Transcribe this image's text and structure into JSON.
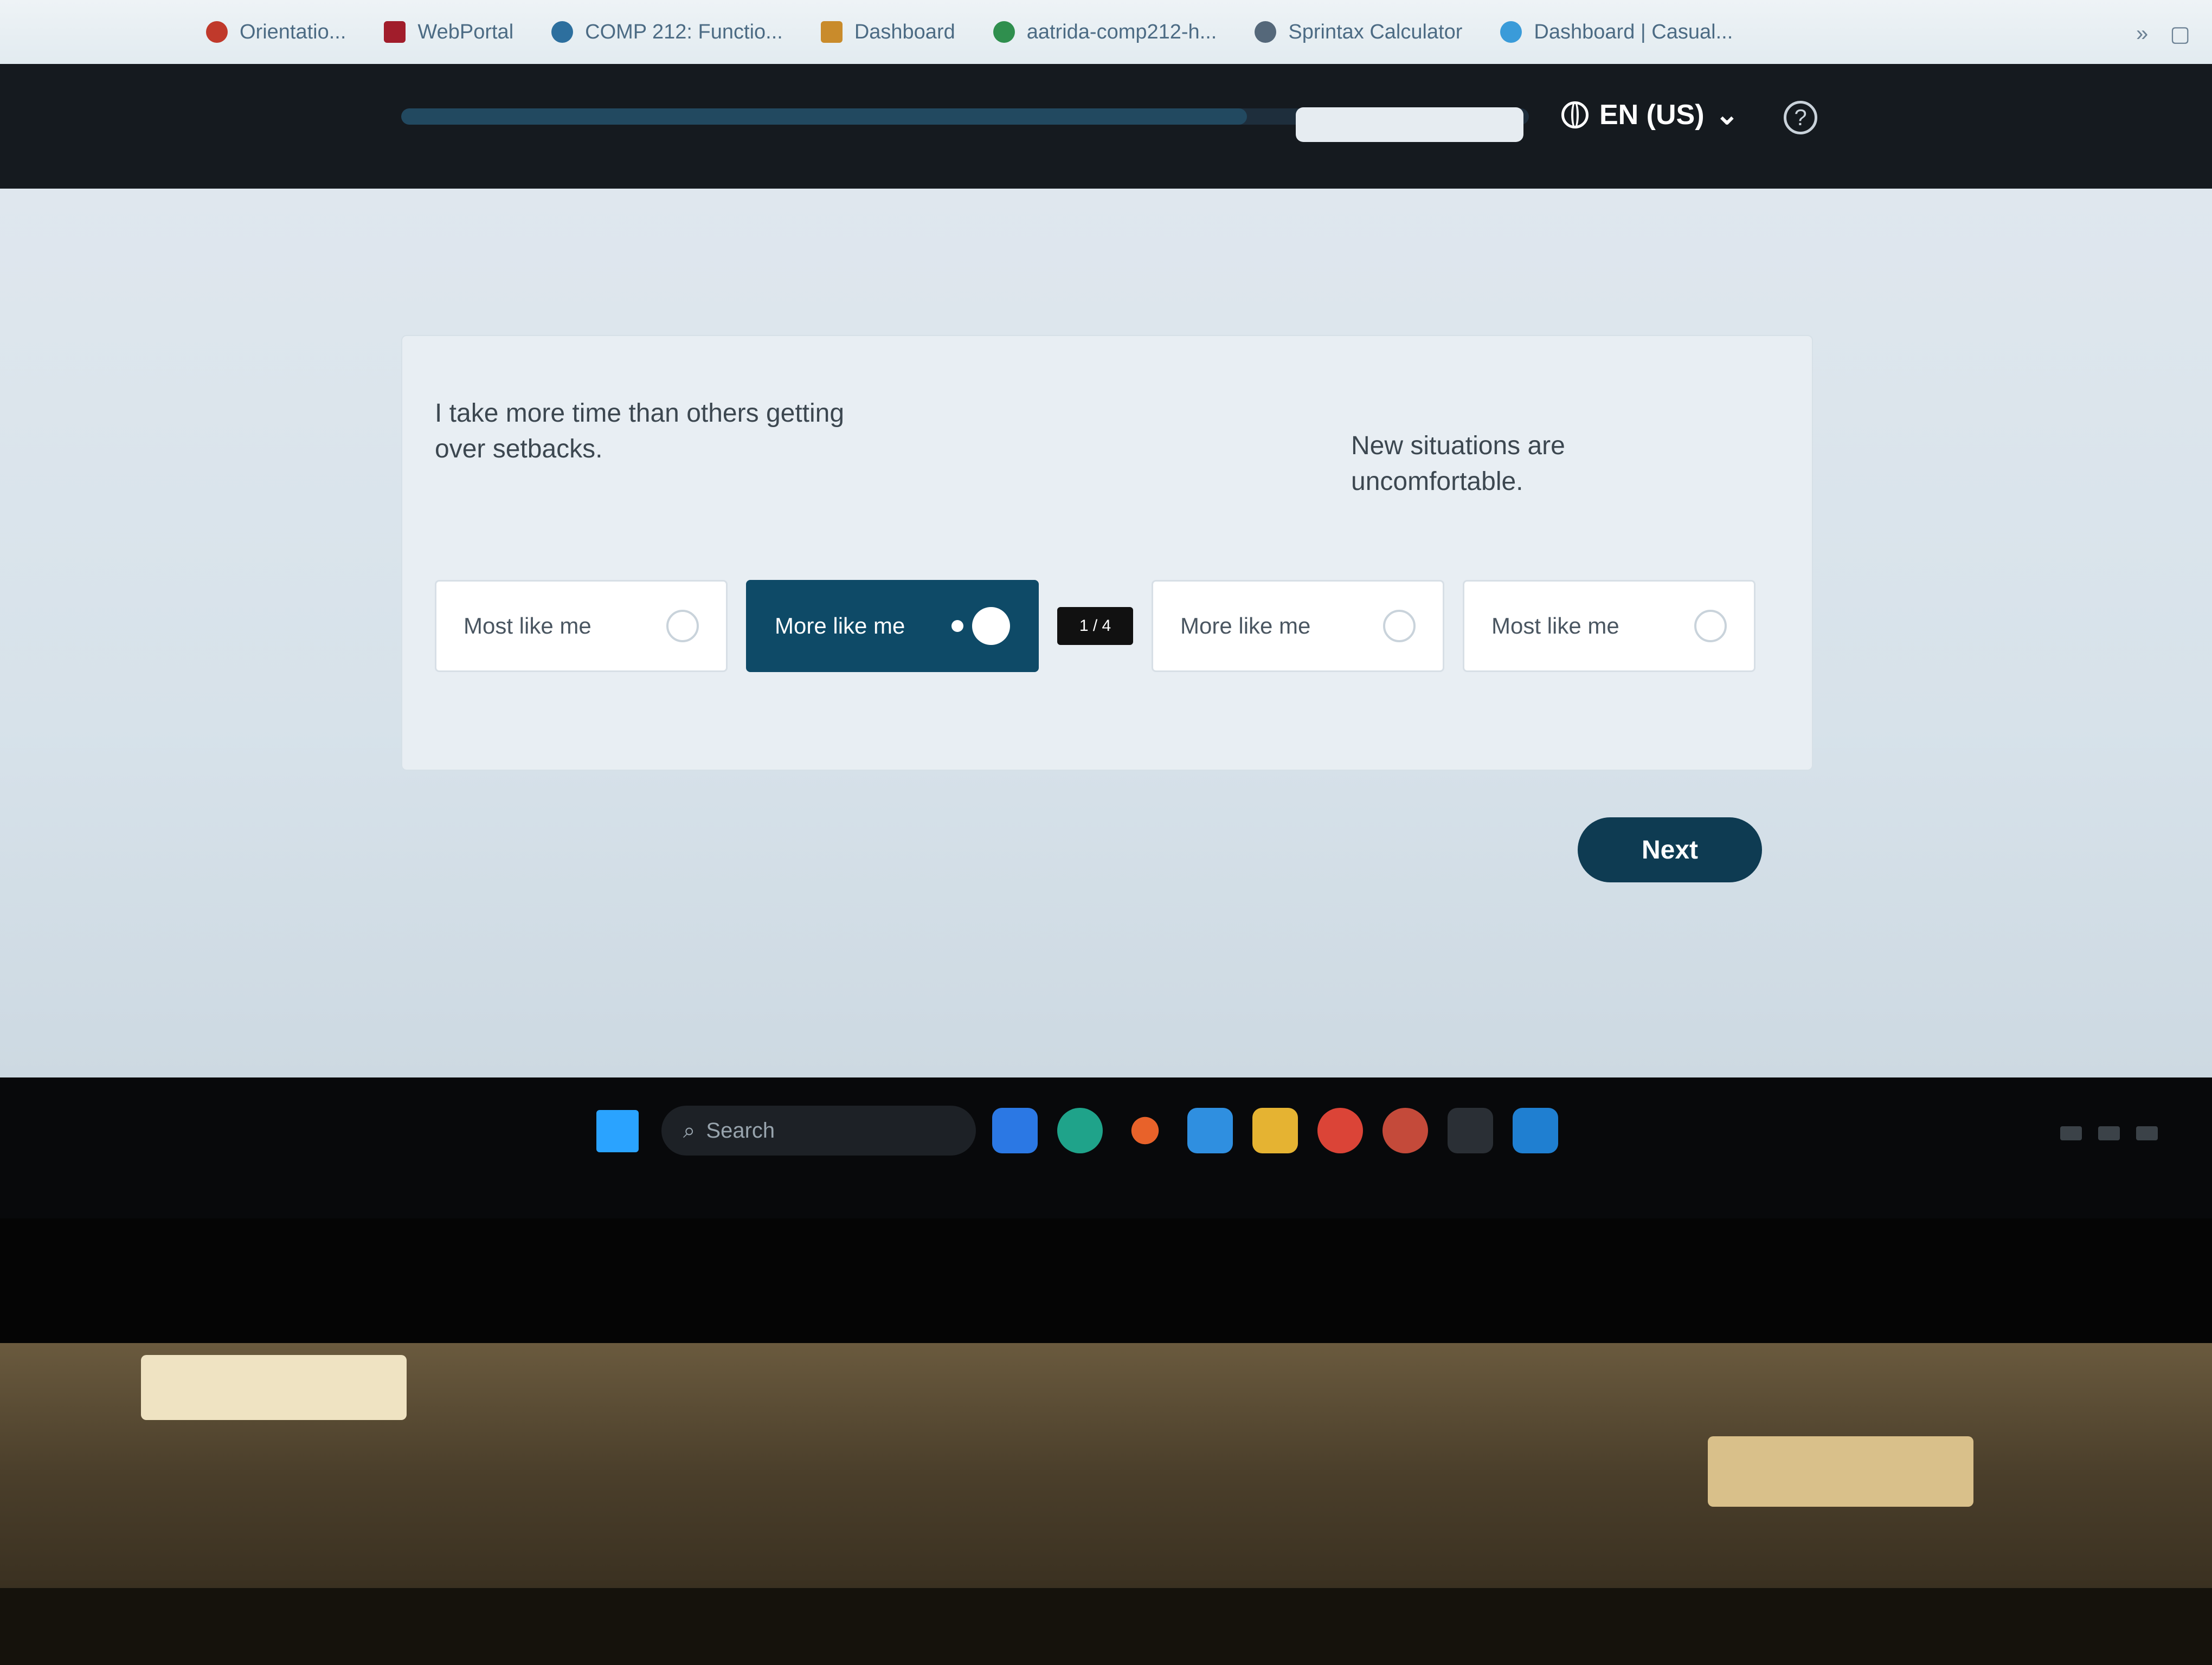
{
  "bookmarks": [
    {
      "label": "Orientatio...",
      "icon": "red-bookmark-icon",
      "color": "#c0392b"
    },
    {
      "label": "WebPortal",
      "icon": "webportal-icon",
      "color": "#a11d2b"
    },
    {
      "label": "COMP 212: Functio...",
      "icon": "globe-icon",
      "color": "#2d6f9e"
    },
    {
      "label": "Dashboard",
      "icon": "dashboard-icon",
      "color": "#c98b2b"
    },
    {
      "label": "aatrida-comp212-h...",
      "icon": "drive-icon",
      "color": "#2f8f4e"
    },
    {
      "label": "Sprintax Calculator",
      "icon": "sprintax-icon",
      "color": "#55687a"
    },
    {
      "label": "Dashboard | Casual...",
      "icon": "casual-icon",
      "color": "#3a9bd9"
    }
  ],
  "header": {
    "language": "EN (US)",
    "help_symbol": "?",
    "progress": 0.75
  },
  "question": {
    "left_statement": "I take more time than others getting over setbacks.",
    "right_statement": "New situations are uncomfortable.",
    "options": [
      {
        "label": "Most like me",
        "selected": false
      },
      {
        "label": "More like me",
        "selected": true
      },
      {
        "label": "More like me",
        "selected": false
      },
      {
        "label": "Most like me",
        "selected": false
      }
    ],
    "tooltip": "1 / 4"
  },
  "next_button": "Next",
  "taskbar": {
    "search_placeholder": "Search",
    "apps": [
      {
        "icon": "copilot-icon",
        "color": "#2b78e4"
      },
      {
        "icon": "edge-icon",
        "color": "#1fa38a"
      },
      {
        "icon": "firefox-icon",
        "color": "#e8622a"
      },
      {
        "icon": "store-icon",
        "color": "#2f8fe0"
      },
      {
        "icon": "file-explorer-icon",
        "color": "#e5b332"
      },
      {
        "icon": "chrome-icon",
        "color": "#db4437"
      },
      {
        "icon": "chrome-profile-icon",
        "color": "#c44a3a"
      },
      {
        "icon": "terminal-icon",
        "color": "#2a2f35"
      },
      {
        "icon": "vscode-icon",
        "color": "#1f7fd1"
      }
    ]
  },
  "colors": {
    "accent": "#0e4a67",
    "header_bg": "#151a1f",
    "page_bg": "#dfe7ee"
  }
}
